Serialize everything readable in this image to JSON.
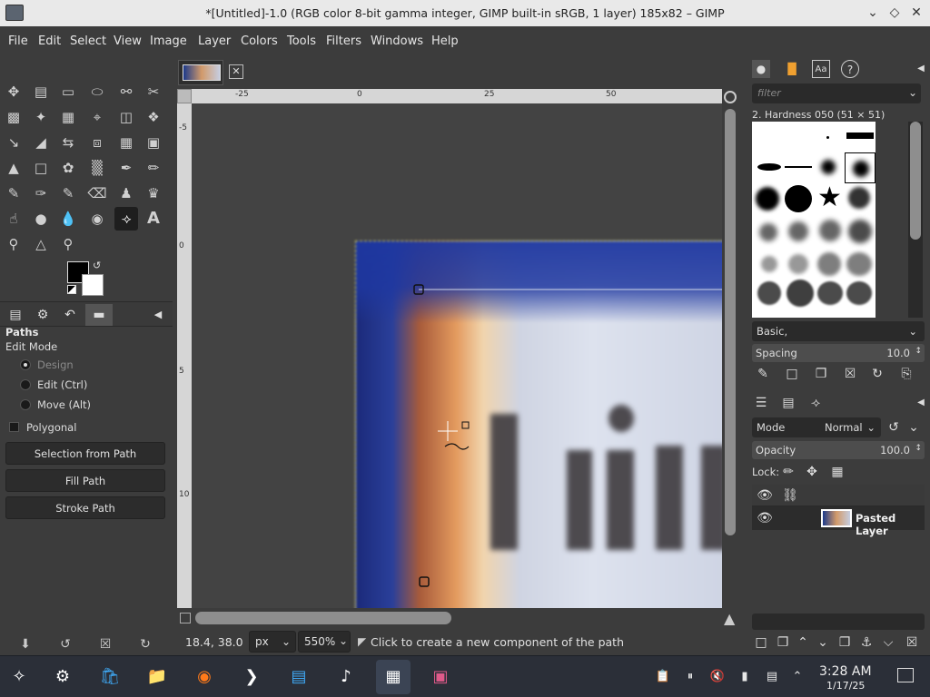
{
  "window": {
    "title": "*[Untitled]-1.0 (RGB color 8-bit gamma integer, GIMP built-in sRGB, 1 layer) 185x82 – GIMP"
  },
  "menu": [
    "File",
    "Edit",
    "Select",
    "View",
    "Image",
    "Layer",
    "Colors",
    "Tools",
    "Filters",
    "Windows",
    "Help"
  ],
  "tool_options": {
    "title": "Paths",
    "edit_mode_label": "Edit Mode",
    "modes": [
      "Design",
      "Edit (Ctrl)",
      "Move (Alt)"
    ],
    "selected_mode": "Design",
    "polygonal_label": "Polygonal",
    "polygonal_checked": false,
    "buttons": [
      "Selection from Path",
      "Fill Path",
      "Stroke Path"
    ]
  },
  "rulers": {
    "horizontal": [
      "-25",
      "0",
      "25",
      "50"
    ],
    "vertical": [
      "-5",
      "0",
      "5",
      "10"
    ]
  },
  "status": {
    "coords": "18.4, 38.0",
    "unit": "px",
    "zoom": "550%",
    "message": "Click to create a new component of the path"
  },
  "brushes": {
    "filter_placeholder": "filter",
    "current": "2. Hardness 050 (51 × 51)",
    "preset": "Basic,",
    "spacing_label": "Spacing",
    "spacing_value": "10.0"
  },
  "layers": {
    "mode_label": "Mode",
    "mode_value": "Normal",
    "opacity_label": "Opacity",
    "opacity_value": "100.0",
    "lock_label": "Lock:",
    "items": [
      {
        "name": "Pasted Layer",
        "visible": true
      }
    ]
  },
  "taskbar": {
    "time": "3:28 AM",
    "date": "1/17/25"
  },
  "colors": {
    "fg": "#000000",
    "bg": "#ffffff",
    "accent": "#e6e060"
  }
}
